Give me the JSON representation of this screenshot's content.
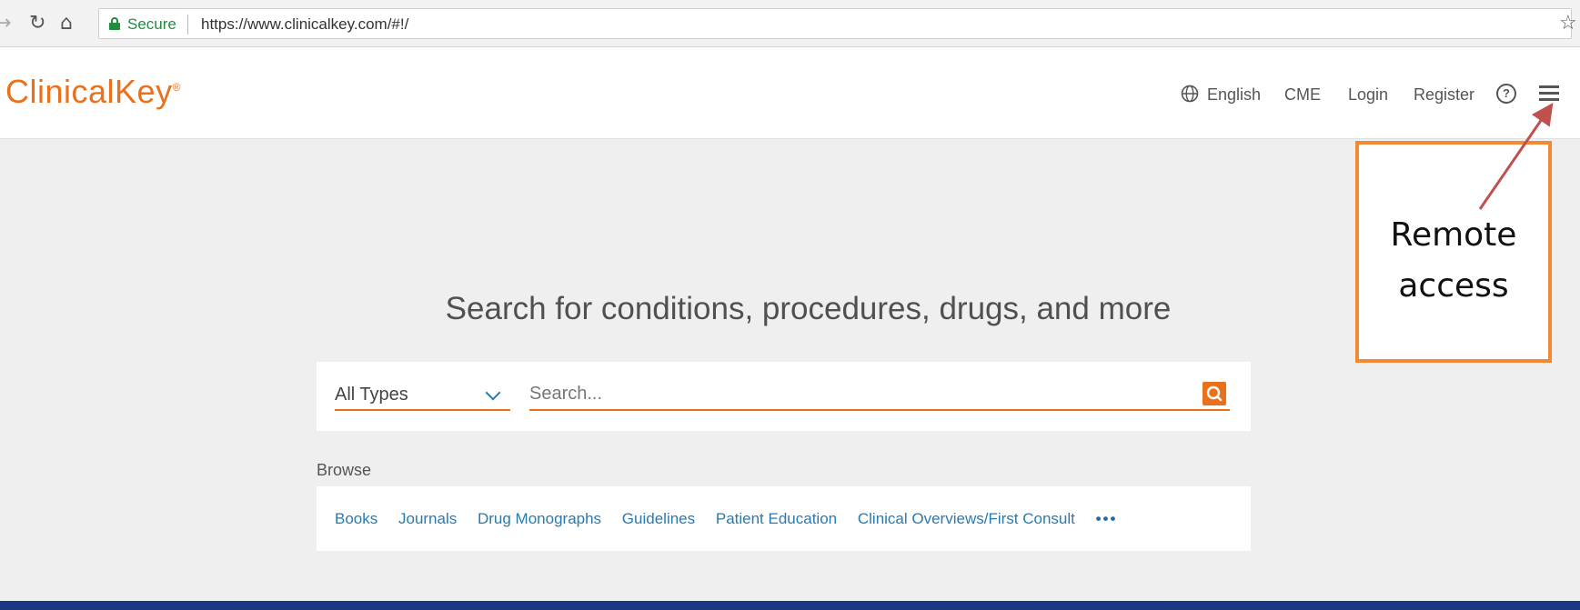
{
  "browser": {
    "secure_label": "Secure",
    "url": "https://www.clinicalkey.com/#!/",
    "back_icon": "arrow-back-icon",
    "reload_icon": "reload-icon",
    "home_icon": "home-icon",
    "star_icon": "star-icon"
  },
  "header": {
    "logo": "ClinicalKey",
    "logo_mark": "®",
    "language": "English",
    "cme": "CME",
    "login": "Login",
    "register": "Register",
    "help_symbol": "?",
    "help_icon": "help-icon",
    "menu_icon": "hamburger-menu-icon"
  },
  "main": {
    "hero_title": "Search for conditions, procedures, drugs, and more",
    "type_select": "All Types",
    "search_placeholder": "Search...",
    "browse_title": "Browse",
    "browse_links": [
      "Books",
      "Journals",
      "Drug Monographs",
      "Guidelines",
      "Patient Education",
      "Clinical Overviews/First Consult"
    ],
    "more": "•••"
  },
  "annotation": {
    "line1": "Remote",
    "line2": "access"
  },
  "colors": {
    "brand_orange": "#e9711c",
    "link_blue": "#2a7ab0",
    "annotation_border": "#f28a35",
    "arrow": "#c0504d",
    "frame_blue": "#1d3a8a"
  }
}
